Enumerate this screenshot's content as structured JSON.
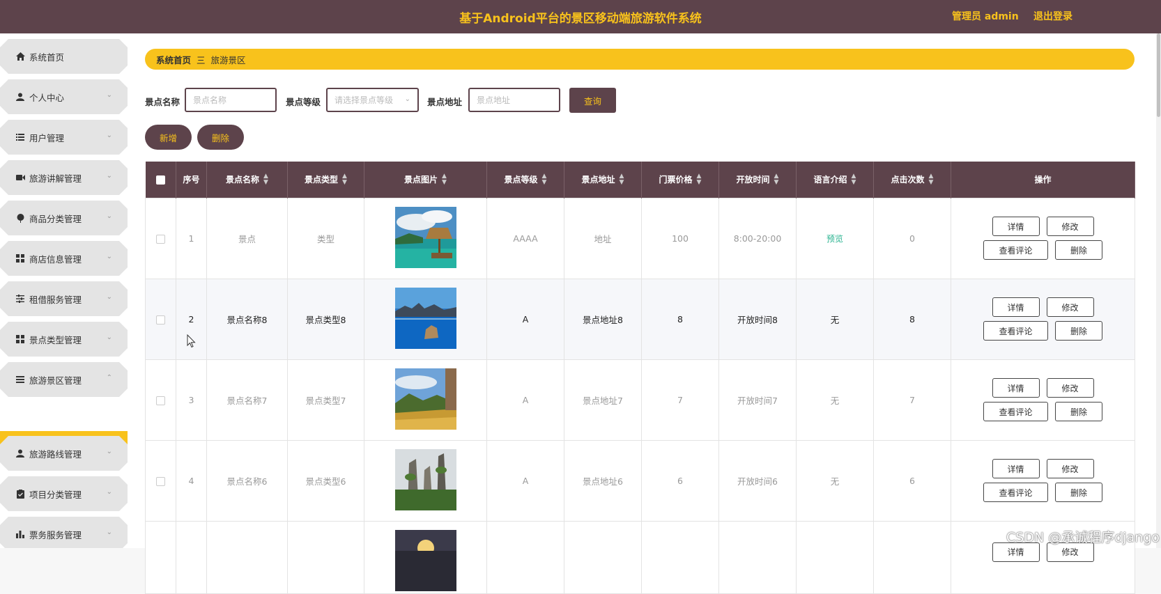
{
  "header": {
    "title": "基于Android平台的景区移动端旅游软件系统",
    "admin_label": "管理员 admin",
    "logout_label": "退出登录"
  },
  "colors": {
    "primary": "#5d434b",
    "accent": "#f8c21c",
    "link": "#2ab390"
  },
  "sidebar": {
    "items": [
      {
        "label": "系统首页",
        "icon": "home-icon",
        "has_chevron": false
      },
      {
        "label": "个人中心",
        "icon": "person-icon",
        "has_chevron": true
      },
      {
        "label": "用户管理",
        "icon": "list-icon",
        "has_chevron": true
      },
      {
        "label": "旅游讲解管理",
        "icon": "video-camera-icon",
        "has_chevron": true
      },
      {
        "label": "商品分类管理",
        "icon": "balloon-icon",
        "has_chevron": true
      },
      {
        "label": "商店信息管理",
        "icon": "grid-icon",
        "has_chevron": true
      },
      {
        "label": "租借服务管理",
        "icon": "sliders-icon",
        "has_chevron": true
      },
      {
        "label": "景点类型管理",
        "icon": "grid-icon",
        "has_chevron": true
      },
      {
        "label": "旅游景区管理",
        "icon": "list-icon",
        "has_chevron": true,
        "expanded": true
      },
      {
        "label": "旅游路线管理",
        "icon": "person-icon",
        "has_chevron": true
      },
      {
        "label": "项目分类管理",
        "icon": "clipboard-icon",
        "has_chevron": true
      },
      {
        "label": "票务服务管理",
        "icon": "bar-chart-icon",
        "has_chevron": true
      }
    ],
    "active_sub": "旅游景区"
  },
  "breadcrumb": {
    "home": "系统首页",
    "separator": "三",
    "current": "旅游景区"
  },
  "filters": {
    "name_label": "景点名称",
    "name_placeholder": "景点名称",
    "level_label": "景点等级",
    "level_placeholder": "请选择景点等级",
    "address_label": "景点地址",
    "address_placeholder": "景点地址",
    "query_label": "查询"
  },
  "actions": {
    "add_label": "新增",
    "delete_label": "删除"
  },
  "table": {
    "columns": [
      "序号",
      "景点名称",
      "景点类型",
      "景点图片",
      "景点等级",
      "景点地址",
      "门票价格",
      "开放时间",
      "语言介绍",
      "点击次数",
      "操作"
    ],
    "rows": [
      {
        "no": "1",
        "name": "景点",
        "type": "类型",
        "image": "tropical-beach-hut",
        "level": "AAAA",
        "address": "地址",
        "price": "100",
        "hours": "8:00-20:00",
        "lang": "预览",
        "clicks": "0"
      },
      {
        "no": "2",
        "name": "景点名称8",
        "type": "景点类型8",
        "image": "blue-lake-rock",
        "level": "A",
        "address": "景点地址8",
        "price": "8",
        "hours": "开放时间8",
        "lang": "无",
        "clicks": "8"
      },
      {
        "no": "3",
        "name": "景点名称7",
        "type": "景点类型7",
        "image": "valley-landscape",
        "level": "A",
        "address": "景点地址7",
        "price": "7",
        "hours": "开放时间7",
        "lang": "无",
        "clicks": "7"
      },
      {
        "no": "4",
        "name": "景点名称6",
        "type": "景点类型6",
        "image": "karst-pillars",
        "level": "A",
        "address": "景点地址6",
        "price": "6",
        "hours": "开放时间6",
        "lang": "无",
        "clicks": "6"
      },
      {
        "no": "",
        "name": "",
        "type": "",
        "image": "sunset-sky",
        "level": "",
        "address": "",
        "price": "",
        "hours": "",
        "lang": "",
        "clicks": ""
      }
    ],
    "row_actions": {
      "detail": "详情",
      "edit": "修改",
      "comments": "查看评论",
      "delete": "删除"
    }
  },
  "watermark": "CSDN @承诚程序django"
}
